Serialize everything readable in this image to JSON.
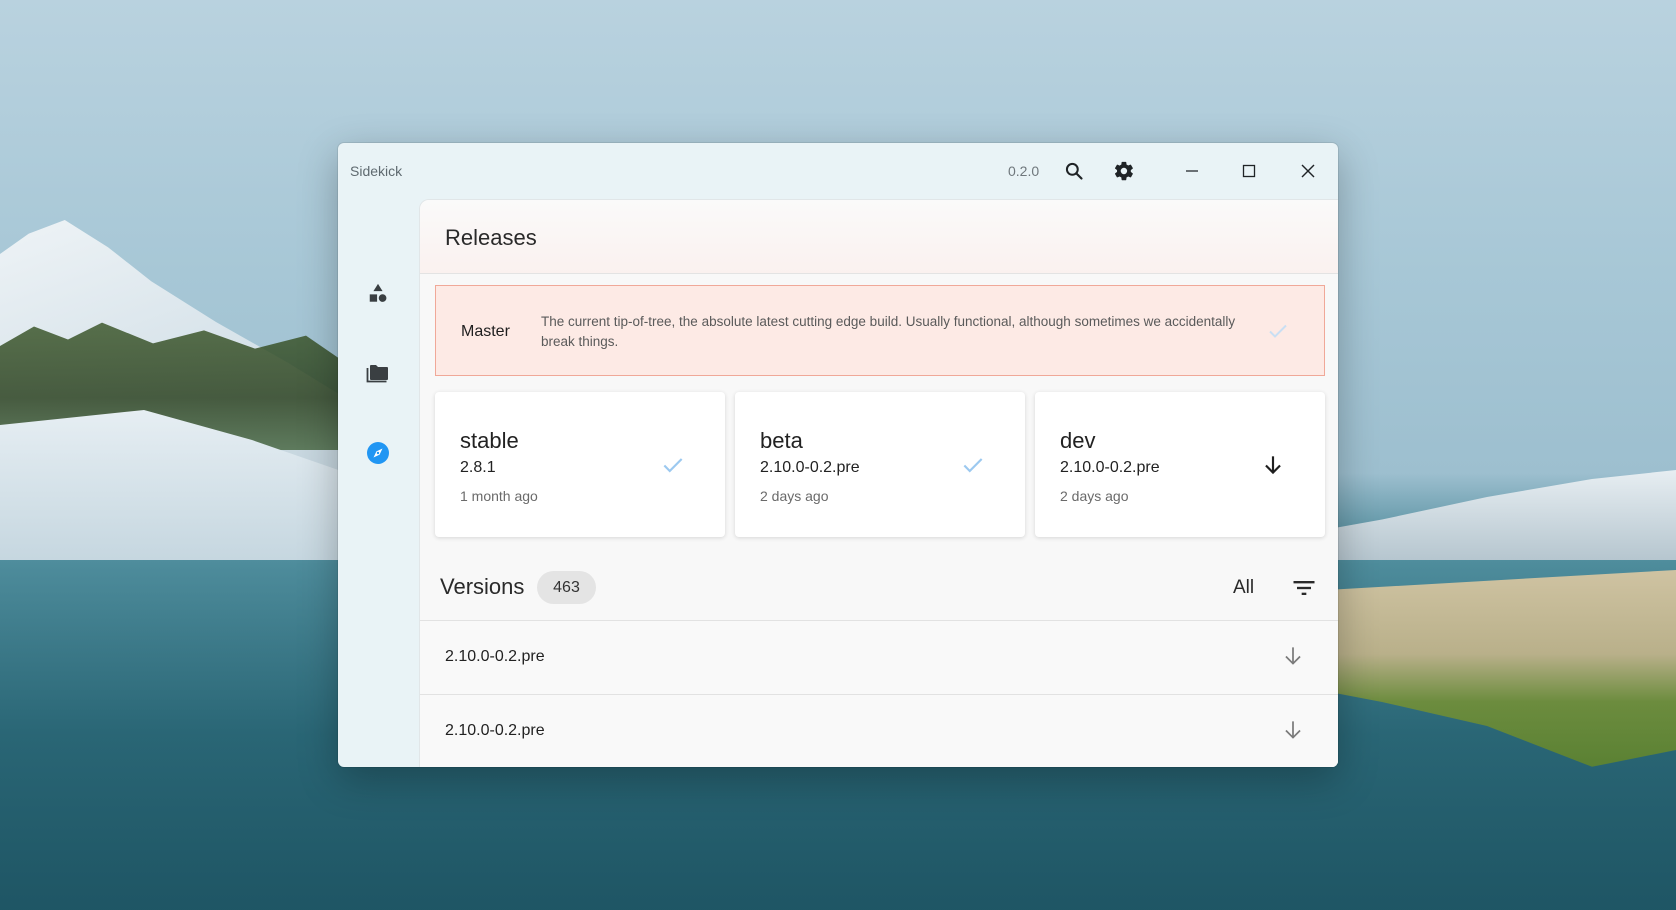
{
  "window": {
    "title": "Sidekick",
    "version": "0.2.0"
  },
  "titlebar_icons": [
    "search-icon",
    "gear-icon",
    "minimize-icon",
    "maximize-icon",
    "close-icon"
  ],
  "sidebar": {
    "items": [
      {
        "icon": "shapes-icon",
        "active": false
      },
      {
        "icon": "folder-icon",
        "active": false
      },
      {
        "icon": "compass-icon",
        "active": true
      }
    ]
  },
  "releases": {
    "title": "Releases",
    "master": {
      "name": "Master",
      "description": "The current tip-of-tree, the absolute latest cutting edge build. Usually functional, although sometimes we accidentally break things."
    },
    "channels": [
      {
        "name": "stable",
        "version": "2.8.1",
        "time": "1 month ago",
        "state": "installed"
      },
      {
        "name": "beta",
        "version": "2.10.0-0.2.pre",
        "time": "2 days ago",
        "state": "installed"
      },
      {
        "name": "dev",
        "version": "2.10.0-0.2.pre",
        "time": "2 days ago",
        "state": "download"
      }
    ]
  },
  "versions": {
    "title": "Versions",
    "count": "463",
    "filter": "All",
    "rows": [
      {
        "label": "2.10.0-0.2.pre"
      },
      {
        "label": "2.10.0-0.2.pre"
      }
    ]
  },
  "colors": {
    "accent": "#2196f3",
    "master_bg": "#fdeae5",
    "master_border": "#f0a898",
    "check": "#9cc9f0"
  }
}
